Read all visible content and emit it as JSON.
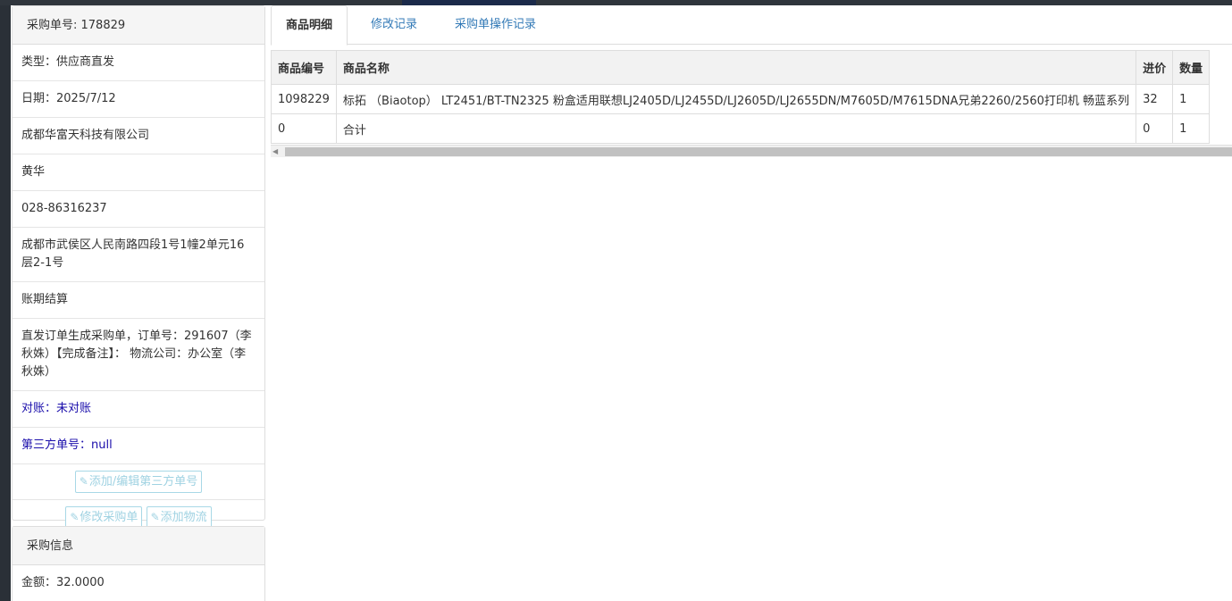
{
  "order": {
    "heading": "采购单号: 178829",
    "type": "类型：供应商直发",
    "date": "日期：2025/7/12",
    "supplier": "成都华富天科技有限公司",
    "contact": "黄华",
    "phone": "028-86316237",
    "address": "成都市武侯区人民南路四段1号1幢2单元16层2-1号",
    "settlement": "账期结算",
    "remark": "直发订单生成采购单，订单号：291607（李秋姝）【完成备注】： 物流公司：办公室（李秋姝）",
    "reconcile": "对账：未对账",
    "third_party_no": "第三方单号：null",
    "btn_edit_third": "添加/编辑第三方单号",
    "btn_modify": "修改采购单",
    "btn_add_logistics": "添加物流"
  },
  "purchase": {
    "heading": "采购信息",
    "amount": "金额：32.0000"
  },
  "tabs": [
    {
      "label": "商品明细"
    },
    {
      "label": "修改记录"
    },
    {
      "label": "采购单操作记录"
    }
  ],
  "table": {
    "headers": [
      "商品编号",
      "商品名称",
      "进价",
      "数量"
    ],
    "rows": [
      [
        "1098229",
        "标拓 （Biaotop） LT2451/BT-TN2325 粉盒适用联想LJ2405D/LJ2455D/LJ2605D/LJ2655DN/M7605D/M7615DNA兄弟2260/2560打印机 畅蓝系列",
        "32",
        "1"
      ],
      [
        "0",
        "合计",
        "0",
        "1"
      ]
    ]
  },
  "icons": {
    "edit": "edit-icon",
    "scroll_left": "scroll-left-arrow-icon"
  }
}
